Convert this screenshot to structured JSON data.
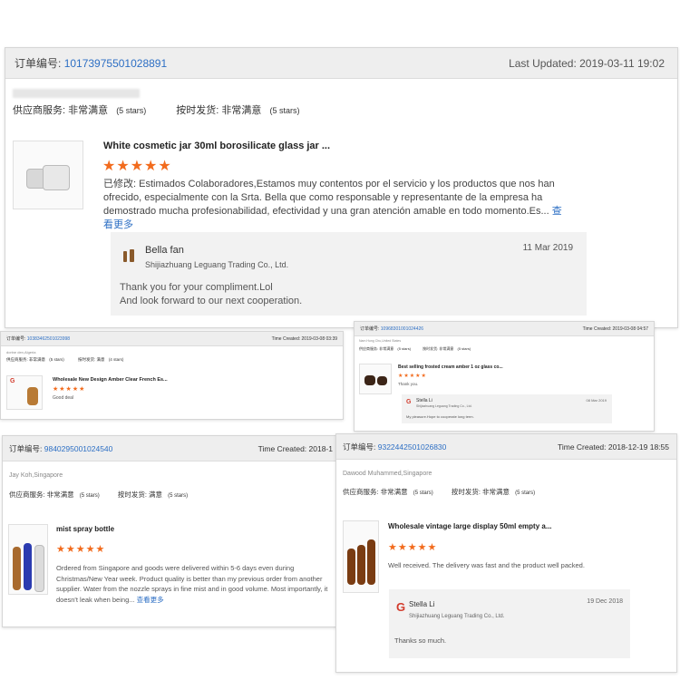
{
  "main": {
    "order_label": "订单编号:",
    "order_no": "10173975501028891",
    "updated": "Last Updated: 2019-03-11 19:02",
    "supplier_service": "供应商服务: 非常满意",
    "supplier_stars": "(5 stars)",
    "delivery": "按时发货: 非常满意",
    "delivery_stars": "(5 stars)",
    "product_title": "White cosmetic jar 30ml borosilicate glass jar ...",
    "stars": "★★★★★",
    "review_prefix": "已修改:",
    "review_text": " Estimados Colaboradores,Estamos muy contentos por el servicio y los productos que nos han ofrecido, especialmente con la Srta. Bella que como responsable y representante de la empresa ha demostrado mucha profesionabilidad, efectividad y una gran atención amable en todo momento.Es...",
    "see_more": "查看更多",
    "reply_name": "Bella fan",
    "reply_company": "Shijiazhuang Leguang Trading Co., Ltd.",
    "reply_date": "11 Mar 2019",
    "reply_line1": "Thank you for your compliment.Lol",
    "reply_line2": "And look forward to our next cooperation."
  },
  "card2": {
    "order_label": "订单编号:",
    "order_no": "10383462501023998",
    "time": "Time Created: 2019-03-08 03:39",
    "buyer": "dorine den,Algeria",
    "supplier_service": "供应商服务: 非常满意",
    "supplier_stars": "(5 stars)",
    "delivery": "按时发货: 满意",
    "delivery_stars": "(4 stars)",
    "product_title": "Wholesale New Design Amber Clear French Es...",
    "stars": "★★★★★",
    "review": "Good deal"
  },
  "card3": {
    "order_label": "订单编号:",
    "order_no": "10968301001024426",
    "time": "Time Created: 2019-03-08 04:57",
    "buyer": "Nam Hung Chu,United States",
    "supplier_service": "供应商服务: 非常满意",
    "supplier_stars": "(5 stars)",
    "delivery": "按时发货: 非常满意",
    "delivery_stars": "(5 stars)",
    "product_title": "Best selling frosted cream amber 1 oz glass co...",
    "stars": "★★★★★",
    "review": "Thank you.",
    "reply_name": "Stella Li",
    "reply_company": "Shijiazhuang Leguang Trading Co., Ltd.",
    "reply_date": "08 Mar 2019",
    "reply_text": "My pleasure.Hope to cooperate long term."
  },
  "card4": {
    "order_label": "订单编号:",
    "order_no": "9840295001024540",
    "time": "Time Created: 2018-1",
    "buyer": "Jay Koh,Singapore",
    "supplier_service": "供应商服务: 非常满意",
    "supplier_stars": "(5 stars)",
    "delivery": "按时发货: 满意",
    "delivery_stars": "(5 stars)",
    "product_title": "mist spray bottle",
    "stars": "★★★★★",
    "review": "Ordered from Singapore and goods were delivered within 5-6 days even during Christmas/New Year week. Product quality is better than my previous order from another supplier. Water from the nozzle sprays in fine mist and in good volume. Most importantly, it doesn't leak when being...",
    "see_more": "查看更多"
  },
  "card5": {
    "order_label": "订单编号:",
    "order_no": "9322442501026830",
    "time": "Time Created: 2018-12-19 18:55",
    "buyer": "Dawood Muhammed,Singapore",
    "supplier_service": "供应商服务: 非常满意",
    "supplier_stars": "(5 stars)",
    "delivery": "按时发货: 非常满意",
    "delivery_stars": "(5 stars)",
    "product_title": "Wholesale vintage large display 50ml empty a...",
    "stars": "★★★★★",
    "review": "Well received. The delivery was fast and the product well packed.",
    "reply_name": "Stella Li",
    "reply_company": "Shijiazhuang Leguang Trading Co., Ltd.",
    "reply_date": "19 Dec 2018",
    "reply_text": "Thanks so much."
  },
  "colors": {
    "accent": "#2d6fc4",
    "star": "#f26b1d",
    "header_bg": "#eeeeee"
  }
}
